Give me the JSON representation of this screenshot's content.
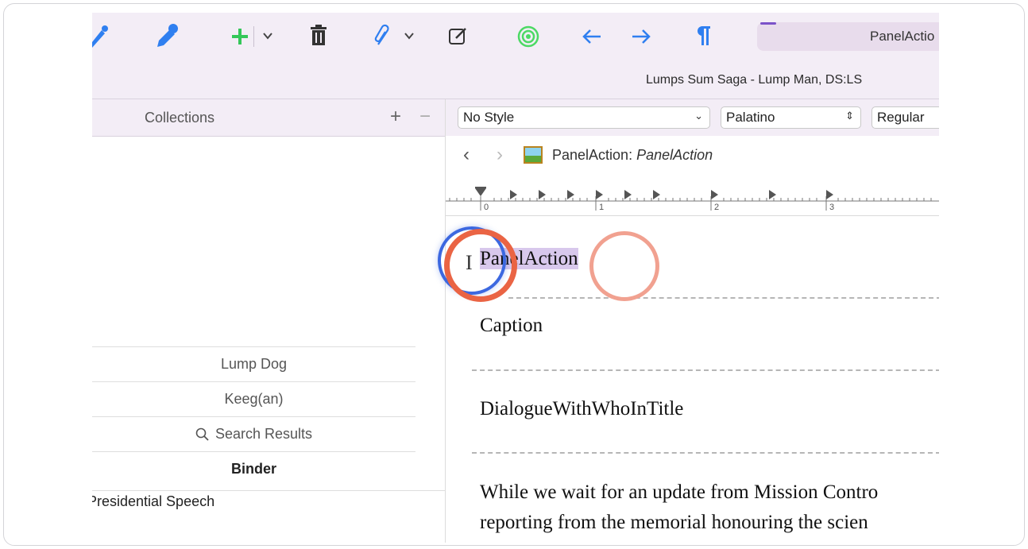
{
  "window": {
    "document_title": "Lumps Sum Saga - Lump Man, DS:LS",
    "tab_label": "PanelActio"
  },
  "toolbar": {
    "icons": [
      "eyedropper-icon",
      "eyedropper-icon",
      "add-icon",
      "chevron-down-icon",
      "trash-icon",
      "paperclip-icon",
      "chevron-down-icon",
      "compose-icon",
      "target-icon",
      "arrow-left-icon",
      "arrow-right-icon",
      "pilcrow-icon"
    ],
    "colors": {
      "accent_blue": "#2f7ff0",
      "green": "#34c759",
      "target_green": "#4cd964"
    }
  },
  "collections": {
    "title": "Collections",
    "add": "+",
    "remove": "−",
    "items": [
      "Lump Dog",
      "Keeg(an)",
      "Search Results",
      "Binder"
    ]
  },
  "binder": {
    "items": [
      "Presidential Speech",
      ":"
    ]
  },
  "format": {
    "style": "No Style",
    "font": "Palatino",
    "weight": "Regular"
  },
  "nav": {
    "back": "‹",
    "forward": "›",
    "doc_name": "PanelAction:",
    "doc_style": "PanelAction"
  },
  "ruler": {
    "labels": [
      "0",
      "1",
      "2",
      "3"
    ]
  },
  "editor": {
    "paragraphs": {
      "p1": "PanelAction",
      "p2": "Caption",
      "p3": "DialogueWithWhoInTitle",
      "p4": "While we wait for an update from Mission Contro",
      "p5": "reporting from the memorial honouring the scien"
    }
  }
}
